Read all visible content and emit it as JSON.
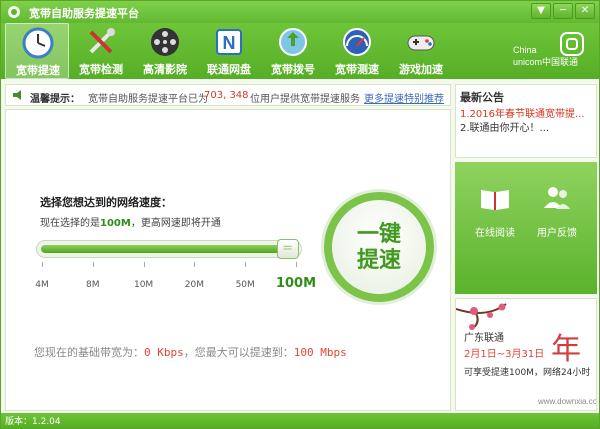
{
  "window": {
    "title": "宽带自助服务提速平台",
    "controls": [
      "▼",
      "─",
      "✕"
    ]
  },
  "toolbar": {
    "items": [
      {
        "label": "宽带提速",
        "icon": "clock-icon",
        "active": true
      },
      {
        "label": "宽带检测",
        "icon": "tools-icon",
        "active": false
      },
      {
        "label": "高清影院",
        "icon": "film-reel-icon",
        "active": false
      },
      {
        "label": "联通网盘",
        "icon": "netdisk-icon",
        "active": false
      },
      {
        "label": "宽带拨号",
        "icon": "globe-icon",
        "active": false
      },
      {
        "label": "宽带测速",
        "icon": "speedometer-icon",
        "active": false
      },
      {
        "label": "游戏加速",
        "icon": "gamepad-icon",
        "active": false
      }
    ],
    "brand": {
      "china": "China",
      "unicom": "unicom中国联通"
    }
  },
  "notice": {
    "label": "温馨提示：",
    "text_a": "宽带自助服务提速平台已为",
    "count": "703, 348",
    "text_b": "位用户提供宽带提速服务",
    "link": "更多提速特别推荐"
  },
  "main": {
    "question": "选择您想达到的网络速度：",
    "current_prefix": "现在选择的是",
    "current_value": "100M",
    "current_suffix": "，更高网速即将开通",
    "slider": {
      "ticks": [
        "4M",
        "8M",
        "10M",
        "20M",
        "50M",
        "100M"
      ],
      "selected_index": 5
    },
    "boost_button": {
      "line1": "一键",
      "line2": "提速"
    },
    "bandwidth": {
      "prefix": "您现在的基础带宽为：",
      "base": "0 Kbps",
      "middle": "，您最大可以提速到：",
      "max": "100 Mbps"
    }
  },
  "sidebar": {
    "news_title": "最新公告",
    "news": [
      "1.2016年春节联通宽带提...",
      "2.联通由你开心！..."
    ],
    "actions": [
      {
        "label": "在线阅读",
        "icon": "book-icon"
      },
      {
        "label": "用户反馈",
        "icon": "users-icon"
      }
    ],
    "ad": {
      "line1": "广东联通",
      "line2": "2月1日~3月31日",
      "line3": "可享受提速100M，网络24小时",
      "watermark": "www.downxia.com"
    }
  },
  "status": {
    "version": "版本：1.2.04"
  },
  "colors": {
    "accent": "#5fb22e",
    "highlight": "#e0443a",
    "link": "#3d6bb6"
  }
}
